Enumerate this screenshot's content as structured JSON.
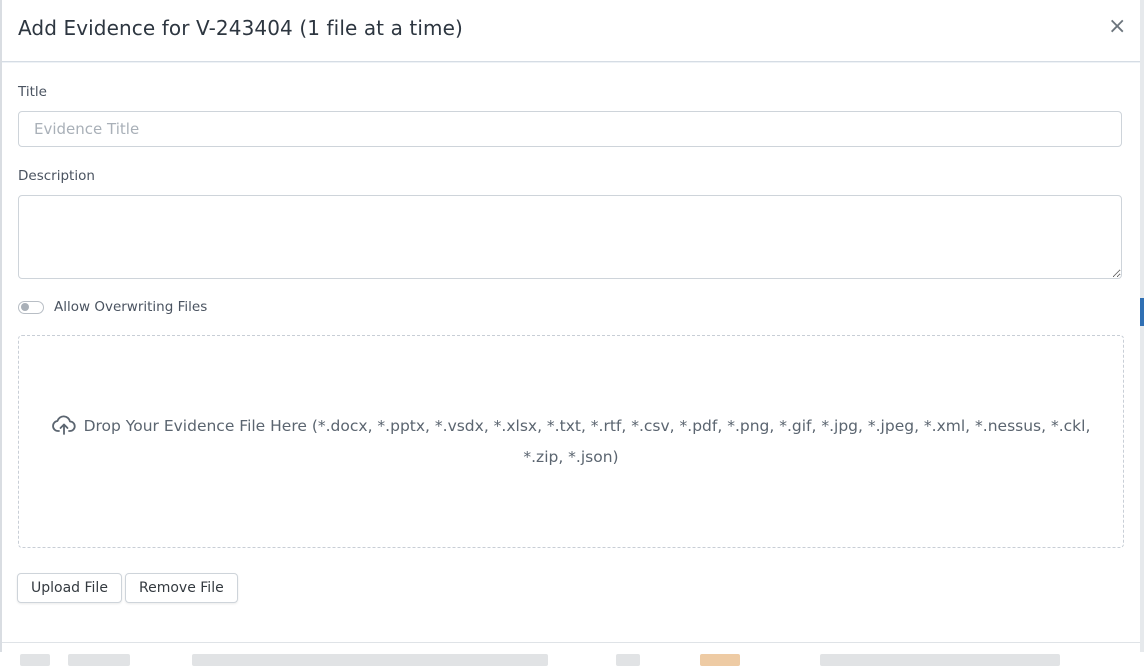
{
  "modal": {
    "title": "Add Evidence for V-243404 (1 file at a time)",
    "close_glyph": "×"
  },
  "form": {
    "title_label": "Title",
    "title_placeholder": "Evidence Title",
    "title_value": "",
    "description_label": "Description",
    "description_value": "",
    "overwrite_label": "Allow Overwriting Files",
    "overwrite_enabled": false
  },
  "dropzone": {
    "icon": "cloud-upload-icon",
    "text": "Drop Your Evidence File Here (*.docx, *.pptx, *.vsdx, *.xlsx, *.txt, *.rtf, *.csv, *.pdf, *.png, *.gif, *.jpg, *.jpeg, *.xml, *.nessus, *.ckl, *.zip, *.json)"
  },
  "actions": {
    "upload_label": "Upload File",
    "remove_label": "Remove File"
  },
  "colors": {
    "accent": "#2f6fb3",
    "text": "#2d3640",
    "border": "#ced4da"
  }
}
